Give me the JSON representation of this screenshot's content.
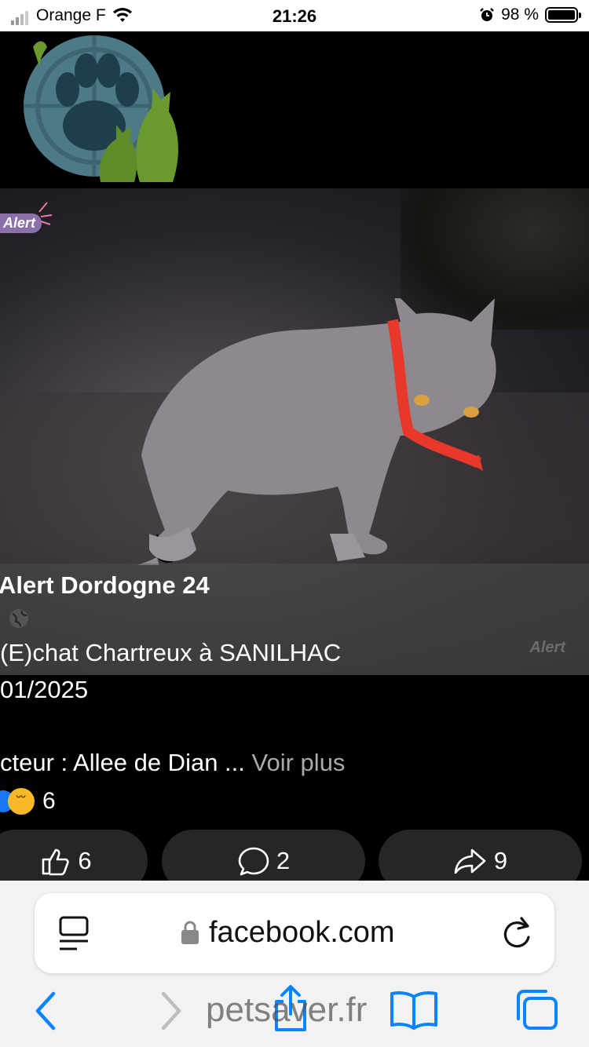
{
  "status_bar": {
    "carrier": "Orange F",
    "time": "21:26",
    "battery": "98 %"
  },
  "photo": {
    "badge": "Alert",
    "watermark": "Alert"
  },
  "post": {
    "name": "Alert Dordogne 24",
    "line1": "(E)chat Chartreux à SANILHAC",
    "line2": "01/2025",
    "line3": "cteur : Allee de Dian ...",
    "see_more": "Voir plus",
    "reaction_count": "6"
  },
  "actions": {
    "like_count": "6",
    "comment_count": "2",
    "share_count": "9"
  },
  "browser": {
    "url": "facebook.com",
    "watermark": "petsaver.fr"
  },
  "colors": {
    "accent": "#1877f2",
    "safari_blue": "#0a84ff",
    "collar": "#e8382c"
  }
}
